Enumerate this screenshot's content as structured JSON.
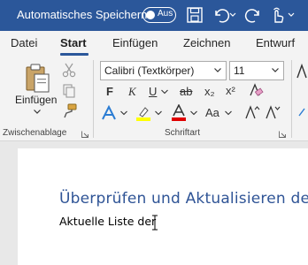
{
  "titlebar": {
    "autosave_label": "Automatisches Speichern",
    "autosave_state": "Aus"
  },
  "tabs": [
    {
      "label": "Datei"
    },
    {
      "label": "Start"
    },
    {
      "label": "Einfügen"
    },
    {
      "label": "Zeichnen"
    },
    {
      "label": "Entwurf"
    }
  ],
  "clipboard": {
    "paste_label": "Einfügen",
    "group_label": "Zwischenablage"
  },
  "font": {
    "font_name": "Calibri (Textkörper)",
    "font_size": "11",
    "bold": "F",
    "italic": "K",
    "underline": "U",
    "strikethrough": "ab",
    "subscript": "x₂",
    "superscript": "x²",
    "case_label": "Aa",
    "group_label": "Schriftart"
  },
  "document": {
    "heading": "Überprüfen und Aktualisieren de",
    "body": "Aktuelle Liste der"
  },
  "colors": {
    "brand": "#2b579a",
    "heading": "#2f5496",
    "highlight": "#ffff00",
    "font_color": "#e00000"
  }
}
